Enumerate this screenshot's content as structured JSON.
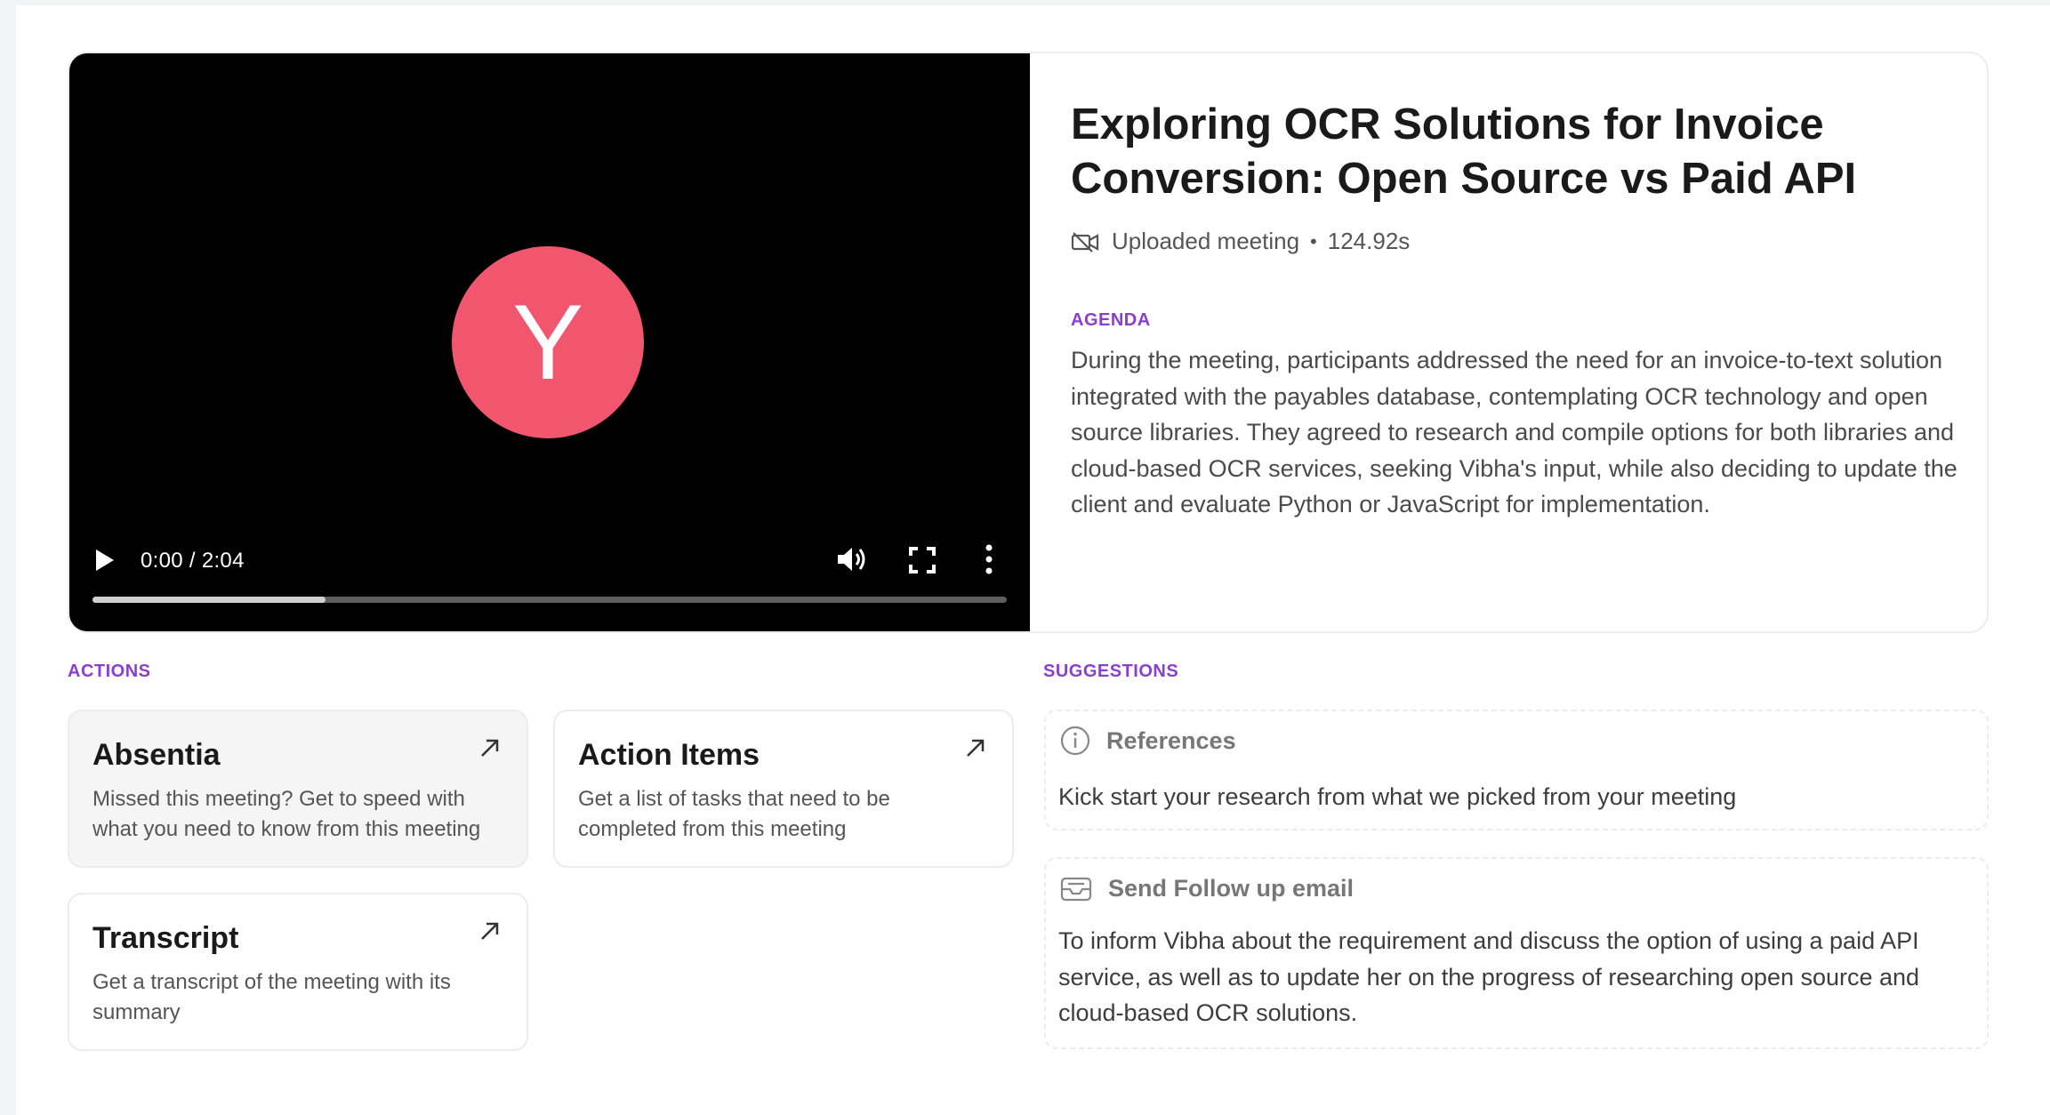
{
  "video": {
    "avatar_letter": "Y",
    "avatar_color": "#f1566e",
    "time_display": "0:00 / 2:04",
    "buffered_fraction": 0.255,
    "icons": [
      "play-icon",
      "volume-icon",
      "fullscreen-icon",
      "more-vertical-icon"
    ]
  },
  "meeting": {
    "title": "Exploring OCR Solutions for Invoice Conversion: Open Source vs Paid API",
    "type": "Uploaded meeting",
    "duration": "124.92s",
    "agenda_label": "AGENDA",
    "agenda": "During the meeting, participants addressed the need for an invoice-to-text solution integrated with the payables database, contemplating OCR technology and open source libraries. They agreed to research and compile options for both libraries and cloud-based OCR services, seeking Vibha's input, while also deciding to update the client and evaluate Python or JavaScript for implementation."
  },
  "actions": {
    "label": "ACTIONS",
    "items": [
      {
        "title": "Absentia",
        "desc": "Missed this meeting? Get to speed with what you need to know from this meeting"
      },
      {
        "title": "Action Items",
        "desc": "Get a list of tasks that need to be completed from this meeting"
      },
      {
        "title": "Transcript",
        "desc": "Get a transcript of the meeting with its summary"
      }
    ]
  },
  "suggestions": {
    "label": "SUGGESTIONS",
    "items": [
      {
        "title": "References",
        "text": "Kick start your research from what we picked from your meeting"
      },
      {
        "title": "Send Follow up email",
        "text": "To inform Vibha about the requirement and discuss the option of using a paid API service, as well as to update her on the progress of researching open source and cloud-based OCR solutions."
      }
    ]
  },
  "colors": {
    "accent": "#8b3fd1",
    "avatar": "#f1566e"
  }
}
